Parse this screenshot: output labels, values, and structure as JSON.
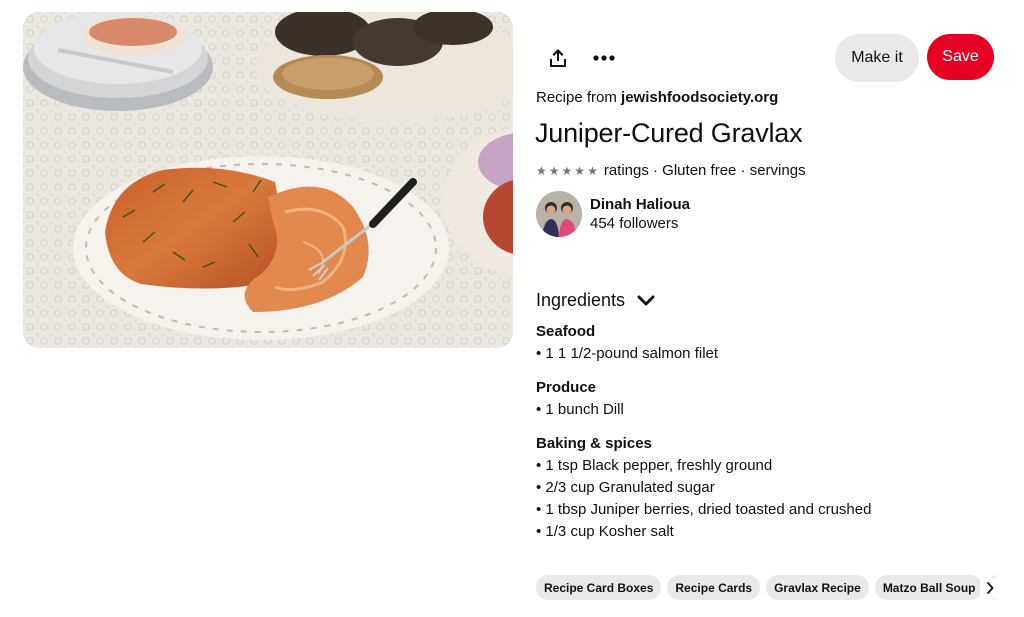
{
  "pin": {
    "image_alt": "Juniper-cured gravlax on a plate with a fork, bagels and cream cheese"
  },
  "actions": {
    "share_icon": "share-icon",
    "more_icon": "more-icon",
    "make_it_label": "Make it",
    "save_label": "Save",
    "save_color": "#e60023"
  },
  "source": {
    "prefix": "Recipe from",
    "domain": "jewishfoodsociety.org"
  },
  "title": "Juniper-Cured Gravlax",
  "meta": {
    "star_count": 5,
    "text": "ratings · Gluten free · servings"
  },
  "creator": {
    "name": "Dinah Halioua",
    "followers": "454 followers"
  },
  "ingredients": {
    "header": "Ingredients",
    "groups": [
      {
        "name": "Seafood",
        "items": [
          "1 1 1/2-pound salmon filet"
        ]
      },
      {
        "name": "Produce",
        "items": [
          "1 bunch Dill"
        ]
      },
      {
        "name": "Baking & spices",
        "items": [
          "1 tsp Black pepper, freshly ground",
          "2/3 cup Granulated sugar",
          "1 tbsp Juniper berries, dried toasted and crushed",
          "1/3 cup Kosher salt"
        ]
      }
    ]
  },
  "tags": [
    "Recipe Card Boxes",
    "Recipe Cards",
    "Gravlax Recipe",
    "Matzo Ball Soup",
    "S"
  ]
}
